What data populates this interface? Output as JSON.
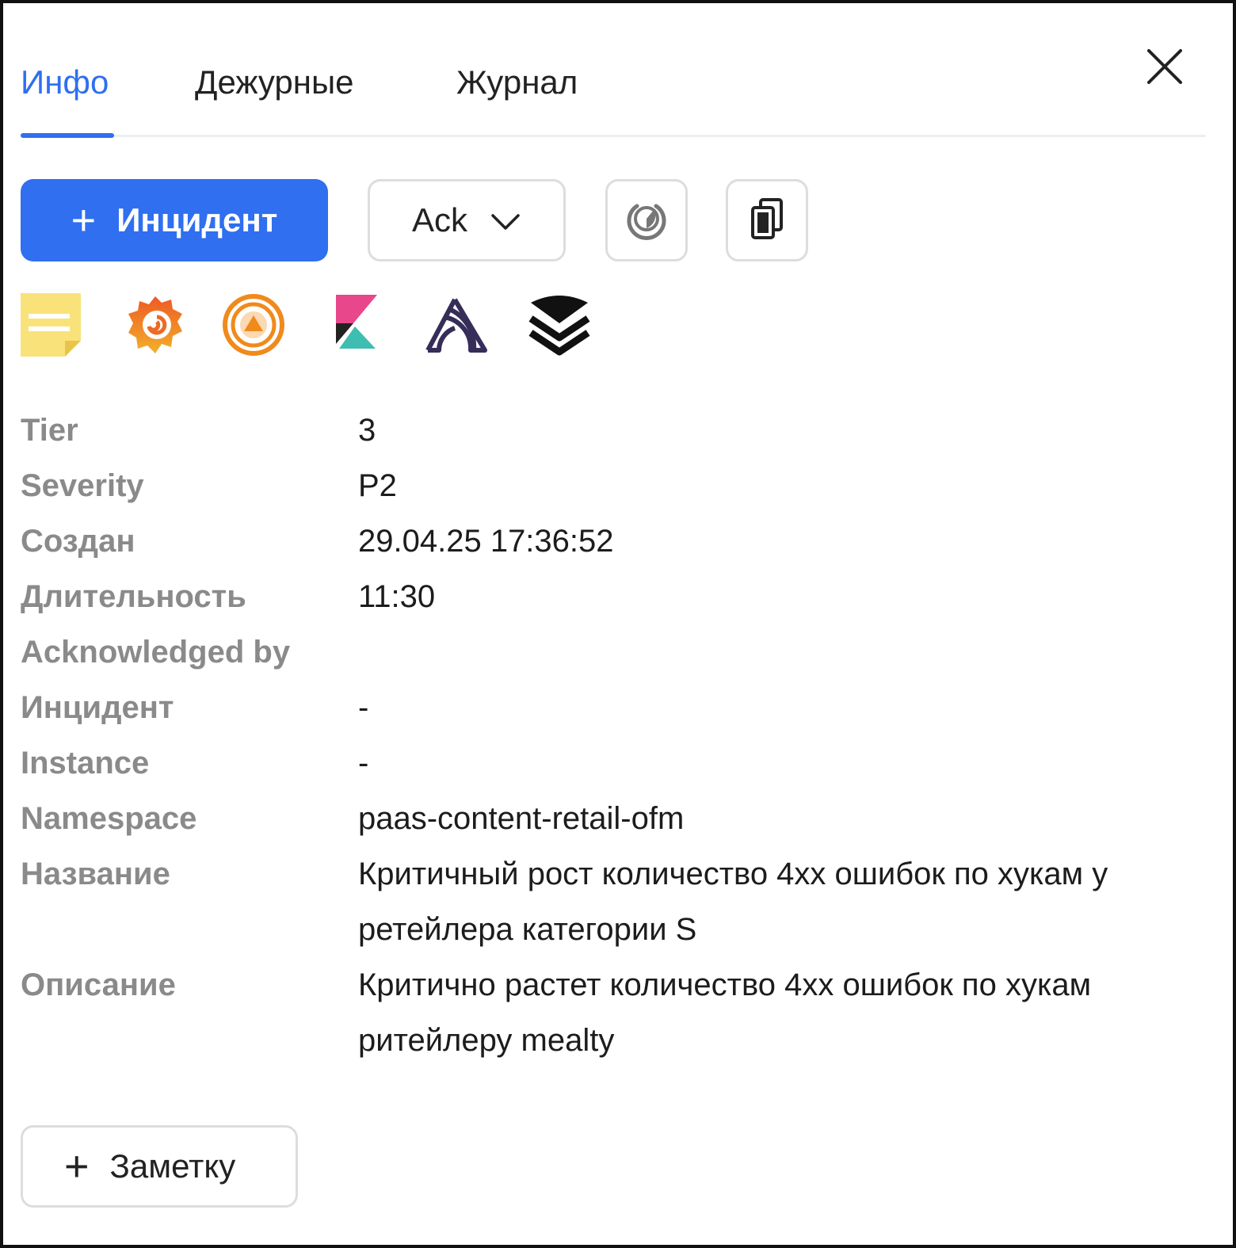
{
  "tabs": {
    "items": [
      {
        "label": "Инфо",
        "active": true
      },
      {
        "label": "Дежурные",
        "active": false
      },
      {
        "label": "Журнал",
        "active": false
      }
    ],
    "active_color": "#2f6ff0"
  },
  "toolbar": {
    "incident_button": {
      "icon": "plus-icon",
      "label": "Инцидент",
      "color": "#2f6ff0"
    },
    "ack_dropdown": {
      "label": "Ack",
      "icon": "chevron-down-icon"
    },
    "snooze_button": {
      "icon": "power-timer-icon"
    },
    "copy_button": {
      "icon": "copy-icon"
    }
  },
  "integrations": [
    {
      "name": "notes",
      "icon": "sticky-note-icon"
    },
    {
      "name": "grafana",
      "icon": "grafana-icon"
    },
    {
      "name": "alert-target",
      "icon": "target-alert-icon"
    },
    {
      "name": "kibana",
      "icon": "kibana-icon"
    },
    {
      "name": "sentry",
      "icon": "sentry-icon"
    },
    {
      "name": "layers",
      "icon": "layers-icon"
    }
  ],
  "info": {
    "tier": {
      "label": "Tier",
      "value": "3"
    },
    "severity": {
      "label": "Severity",
      "value": "P2"
    },
    "created": {
      "label": "Создан",
      "value": "29.04.25 17:36:52"
    },
    "duration": {
      "label": "Длительность",
      "value": "11:30"
    },
    "acknowledged_by": {
      "label": "Acknowledged by",
      "value": ""
    },
    "incident": {
      "label": "Инцидент",
      "value": "-"
    },
    "instance": {
      "label": "Instance",
      "value": "-"
    },
    "namespace": {
      "label": "Namespace",
      "value": "paas-content-retail-ofm"
    },
    "name": {
      "label": "Название",
      "value": "Критичный рост количество 4xx ошибок по хукам у ретейлера категории S"
    },
    "description": {
      "label": "Описание",
      "value": "Критично растет количество 4xx ошибок по хукам ритейлеру mealty"
    }
  },
  "note_button": {
    "icon": "plus-icon",
    "label": "Заметку"
  }
}
